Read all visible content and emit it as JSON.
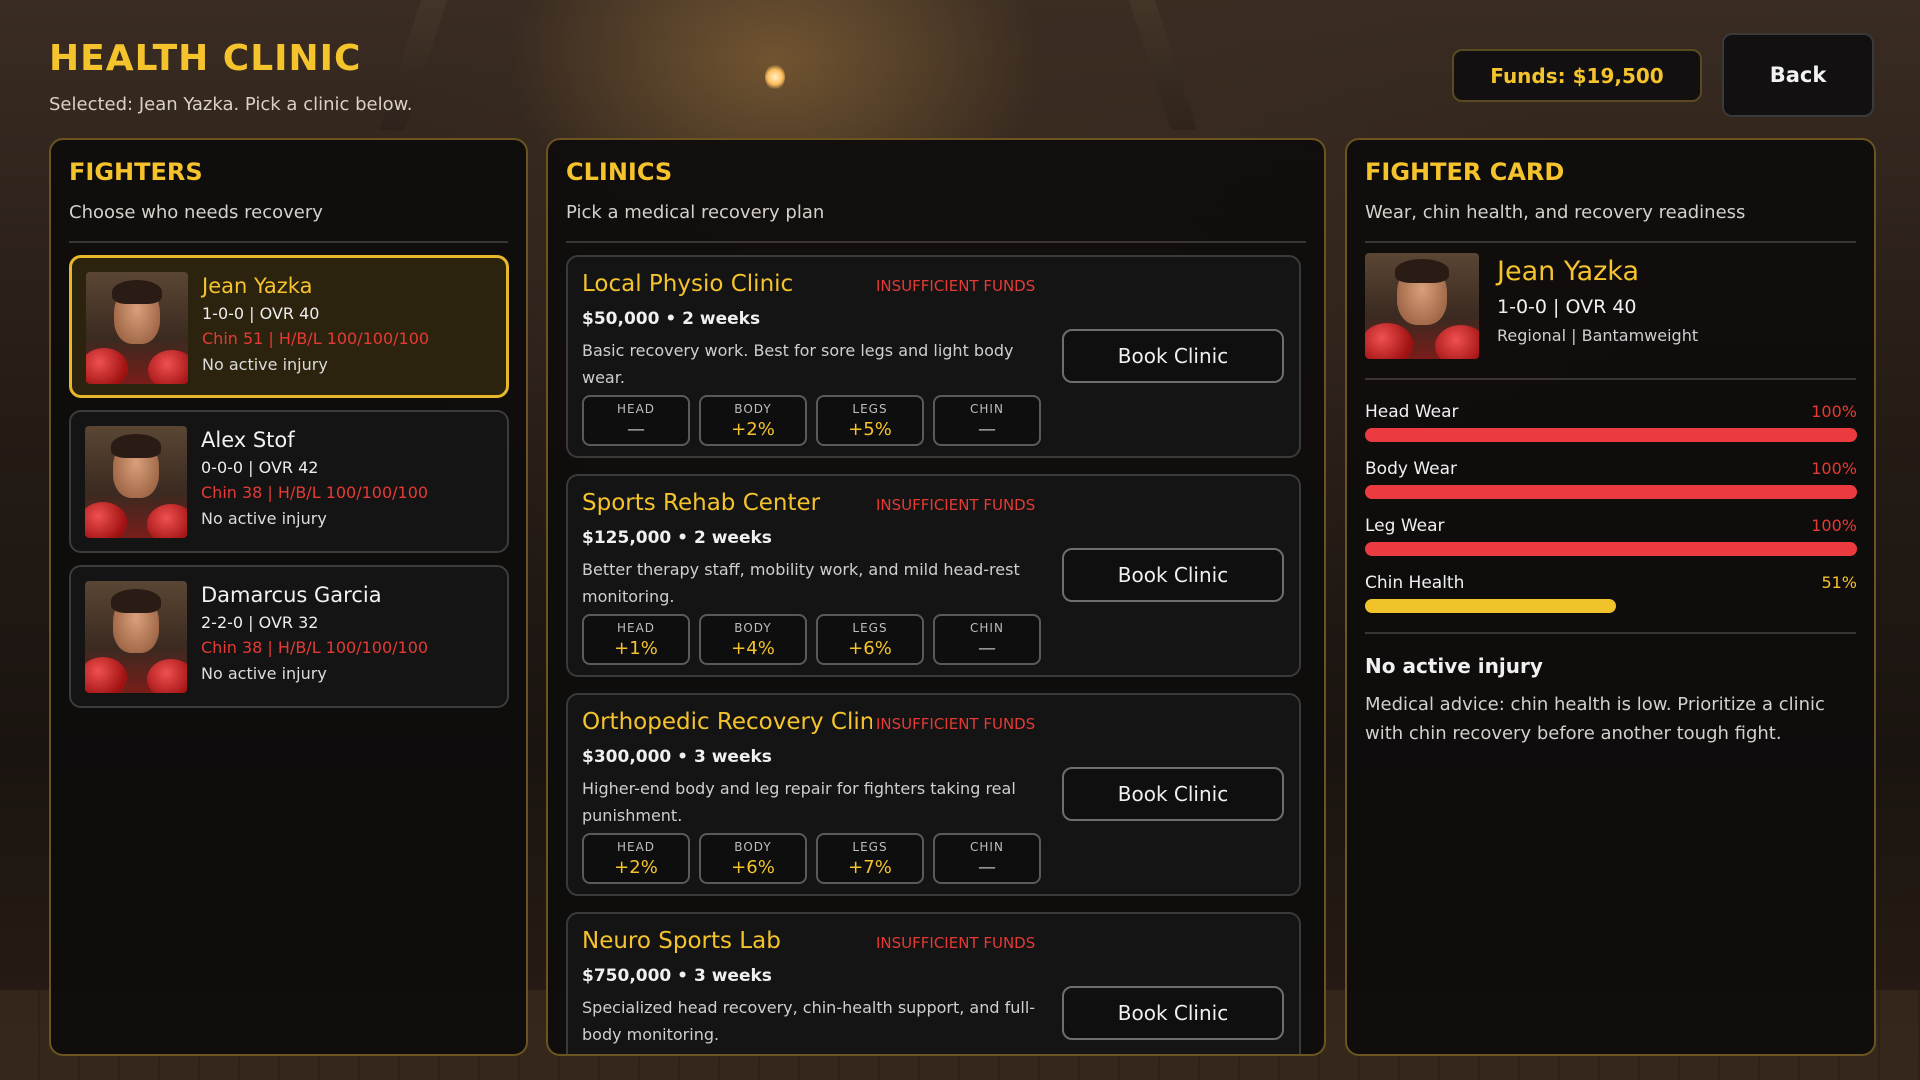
{
  "header": {
    "title": "HEALTH CLINIC",
    "subtitle": "Selected: Jean Yazka. Pick a clinic below.",
    "funds": "Funds: $19,500",
    "back_label": "Back"
  },
  "fighters_panel": {
    "title": "FIGHTERS",
    "subtitle": "Choose who needs recovery",
    "items": [
      {
        "name": "Jean Yazka",
        "record": "1-0-0  |  OVR 40",
        "chin": "Chin 51  |  H/B/L 100/100/100",
        "injury": "No active injury",
        "selected": true
      },
      {
        "name": "Alex Stof",
        "record": "0-0-0  |  OVR 42",
        "chin": "Chin 38  |  H/B/L 100/100/100",
        "injury": "No active injury",
        "selected": false
      },
      {
        "name": "Damarcus Garcia",
        "record": "2-2-0  |  OVR 32",
        "chin": "Chin 38  |  H/B/L 100/100/100",
        "injury": "No active injury",
        "selected": false
      }
    ]
  },
  "clinics_panel": {
    "title": "CLINICS",
    "subtitle": "Pick a medical recovery plan",
    "book_label": "Book Clinic",
    "stat_labels": {
      "head": "HEAD",
      "body": "BODY",
      "legs": "LEGS",
      "chin": "CHIN"
    },
    "items": [
      {
        "name": "Local Physio Clinic",
        "warning": "INSUFFICIENT FUNDS",
        "price": "$50,000  •  2 weeks",
        "desc": "Basic recovery work. Best for sore legs and light body wear.",
        "head": "—",
        "body": "+2%",
        "legs": "+5%",
        "chin": "—"
      },
      {
        "name": "Sports Rehab Center",
        "warning": "INSUFFICIENT FUNDS",
        "price": "$125,000  •  2 weeks",
        "desc": "Better therapy staff, mobility work, and mild head-rest monitoring.",
        "head": "+1%",
        "body": "+4%",
        "legs": "+6%",
        "chin": "—"
      },
      {
        "name": "Orthopedic Recovery Clinic",
        "warning": "INSUFFICIENT FUNDS",
        "price": "$300,000  •  3 weeks",
        "desc": "Higher-end body and leg repair for fighters taking real punishment.",
        "head": "+2%",
        "body": "+6%",
        "legs": "+7%",
        "chin": "—"
      },
      {
        "name": "Neuro Sports Lab",
        "warning": "INSUFFICIENT FUNDS",
        "price": "$750,000  •  3 weeks",
        "desc": "Specialized head recovery, chin-health support, and full-body monitoring.",
        "head": "",
        "body": "",
        "legs": "",
        "chin": ""
      }
    ]
  },
  "card_panel": {
    "title": "FIGHTER CARD",
    "subtitle": "Wear, chin health, and recovery readiness",
    "name": "Jean Yazka",
    "record": "1-0-0  |  OVR 40",
    "division": "Regional  |  Bantamweight",
    "meters": [
      {
        "label": "Head Wear",
        "value": "100%",
        "fraction": 1.0
      },
      {
        "label": "Body Wear",
        "value": "100%",
        "fraction": 1.0
      },
      {
        "label": "Leg Wear",
        "value": "100%",
        "fraction": 1.0
      },
      {
        "label": "Chin Health",
        "value": "51%",
        "fraction": 0.51
      }
    ],
    "injury": "No active injury",
    "advice": "Medical advice: chin health is low. Prioritize a clinic with chin recovery before another tough fight."
  },
  "colors": {
    "accent_gold": "#F5C32C",
    "warning_red": "#E53A35",
    "wear_bar": "#EC3B40",
    "chin_bar": "#F0C32A"
  }
}
